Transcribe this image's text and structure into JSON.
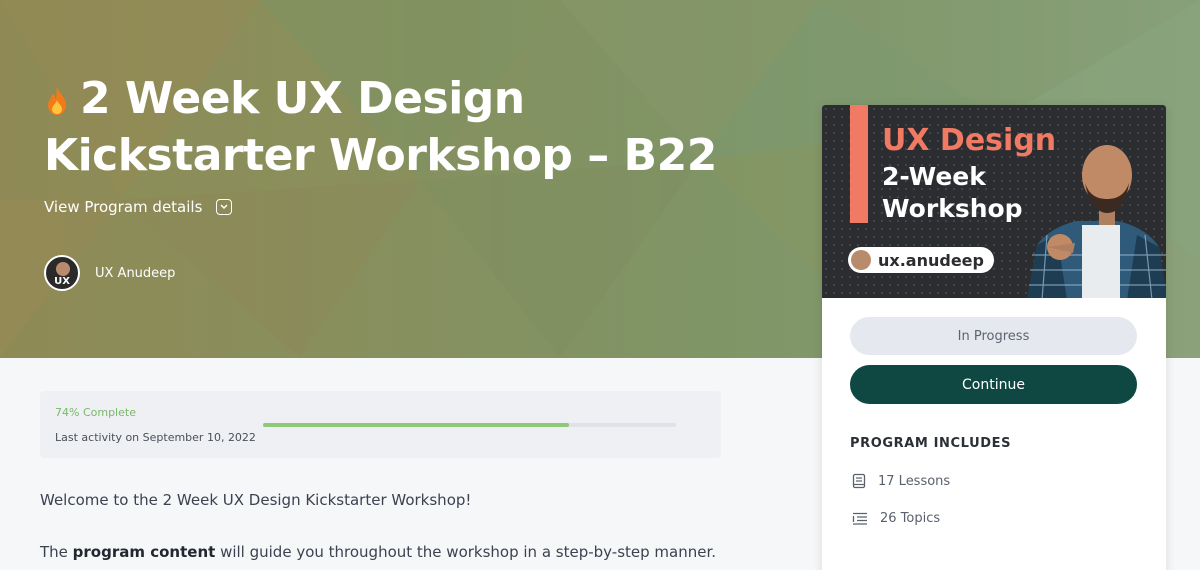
{
  "header": {
    "title_line1": "2 Week UX Design",
    "title_line2": "Kickstarter Workshop – B22",
    "view_details_label": "View Program details",
    "author_name": "UX Anudeep",
    "avatar_text": "UX"
  },
  "card": {
    "thumb_line1": "UX Design",
    "thumb_line2": "2-Week Workshop",
    "thumb_handle": "ux.anudeep",
    "status_label": "In Progress",
    "continue_label": "Continue",
    "includes_title": "PROGRAM INCLUDES",
    "lessons_label": "17 Lessons",
    "topics_label": "26 Topics"
  },
  "progress": {
    "percent_label": "74% Complete",
    "percent_value": 74,
    "last_activity": "Last activity on September 10, 2022"
  },
  "content": {
    "welcome_text": "Welcome to the 2 Week UX Design Kickstarter Workshop!",
    "para_prefix": "The ",
    "para_bold": "program content",
    "para_suffix": " will guide you throughout the workshop in a step-by-step manner."
  },
  "colors": {
    "continue_bg": "#0f4842",
    "accent_orange": "#f07a63",
    "progress_green": "#8ec87a"
  }
}
